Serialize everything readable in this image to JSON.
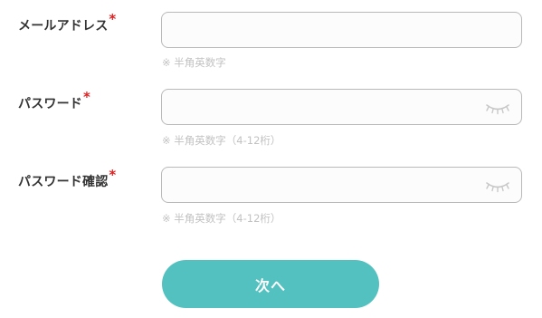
{
  "form": {
    "email": {
      "label": "メールアドレス",
      "required_mark": "*",
      "value": "",
      "placeholder": "",
      "hint": "※ 半角英数字"
    },
    "password": {
      "label": "パスワード",
      "required_mark": "*",
      "value": "",
      "placeholder": "",
      "hint": "※ 半角英数字（4-12桁）",
      "toggle_icon": "eye-closed-icon"
    },
    "password_confirm": {
      "label": "パスワード確認",
      "required_mark": "*",
      "value": "",
      "placeholder": "",
      "hint": "※ 半角英数字（4-12桁）",
      "toggle_icon": "eye-closed-icon"
    },
    "submit_label": "次へ"
  },
  "colors": {
    "accent": "#52c1bf",
    "required": "#e02020",
    "hint": "#c2c2c2",
    "label": "#333333",
    "field_border": "#b9b9b9"
  }
}
